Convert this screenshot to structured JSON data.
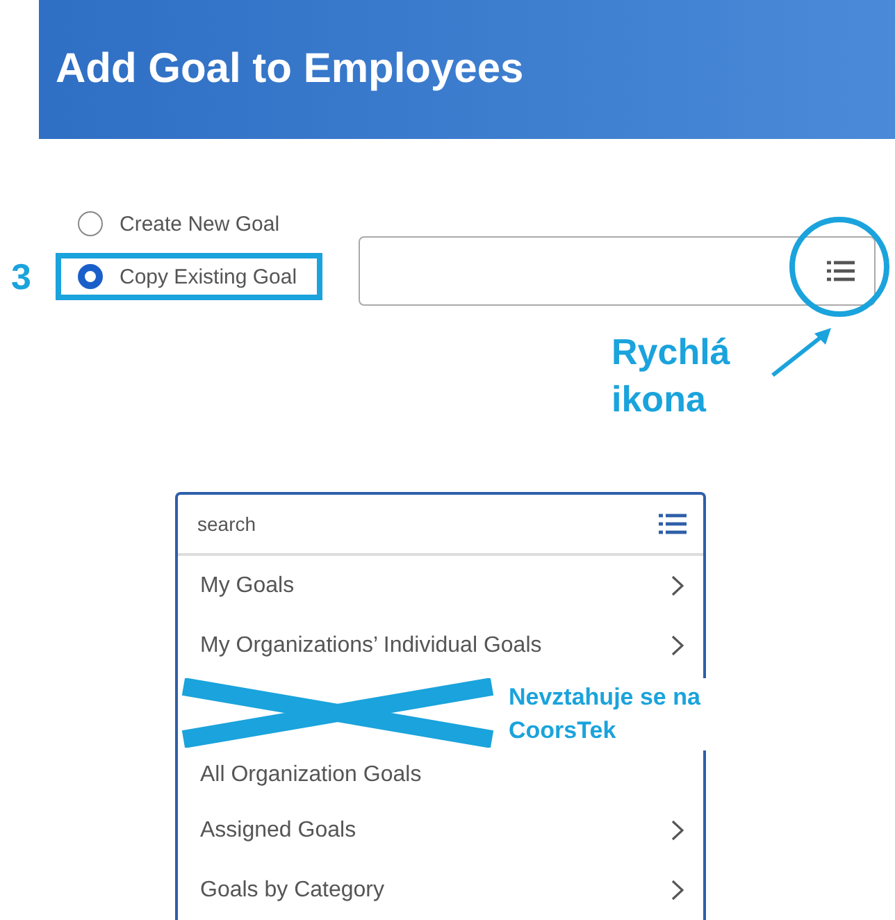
{
  "header": {
    "title": "Add Goal to Employees"
  },
  "options": [
    {
      "label": "Create New Goal",
      "selected": false,
      "highlighted": false
    },
    {
      "label": "Copy Existing Goal",
      "selected": true,
      "highlighted": true
    }
  ],
  "step_number": "3",
  "icon_callout": {
    "lines": [
      "Rychlá",
      "ikona"
    ]
  },
  "dropdown": {
    "search_placeholder": "search",
    "items": [
      {
        "kind": "link",
        "label": "My Goals"
      },
      {
        "kind": "link",
        "label": "My Organizations’ Individual Goals"
      },
      {
        "kind": "crossed"
      },
      {
        "kind": "plain",
        "label": "All Organization Goals"
      },
      {
        "kind": "link",
        "label": "Assigned Goals"
      },
      {
        "kind": "link",
        "label": "Goals by Category"
      }
    ]
  },
  "cross_note": {
    "lines": [
      "Nevztahuje se na",
      "CoorsTek"
    ]
  }
}
